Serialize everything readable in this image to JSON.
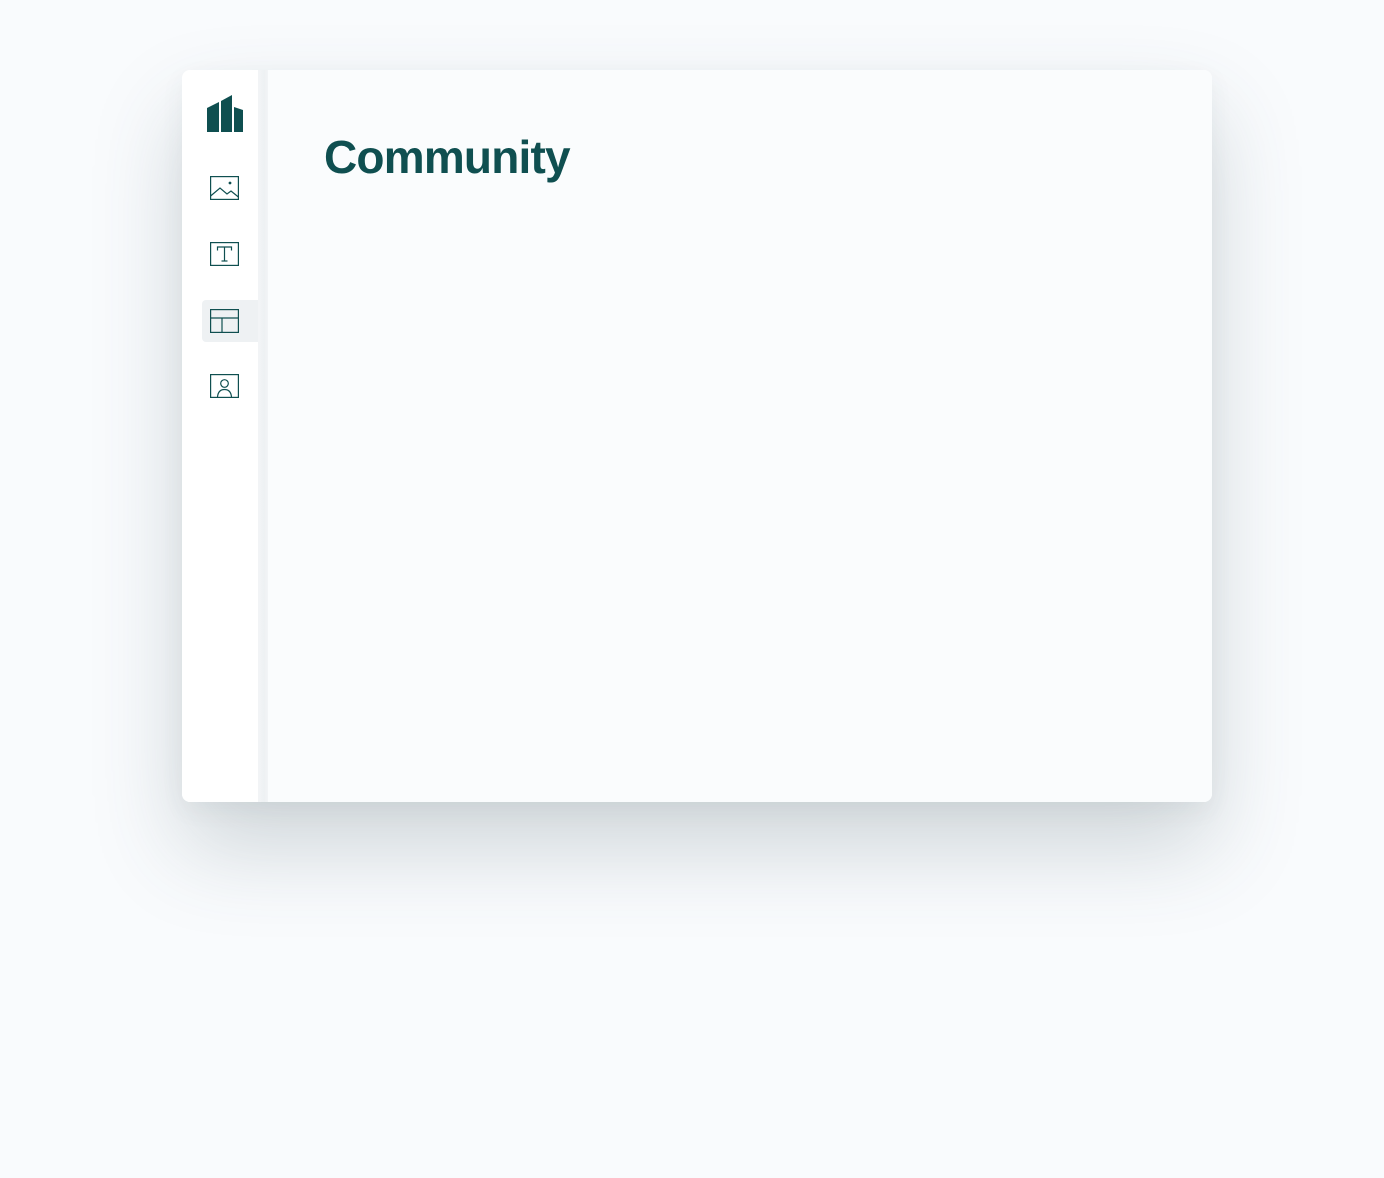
{
  "app": {
    "accent_color": "#0f4f50",
    "logo": "brand-logo-icon"
  },
  "sidebar": {
    "items": [
      {
        "id": "images",
        "icon": "image-icon",
        "active": false
      },
      {
        "id": "text",
        "icon": "text-icon",
        "active": false
      },
      {
        "id": "layout",
        "icon": "layout-icon",
        "active": true
      },
      {
        "id": "profile",
        "icon": "user-card-icon",
        "active": false
      }
    ]
  },
  "main": {
    "title": "Community"
  }
}
